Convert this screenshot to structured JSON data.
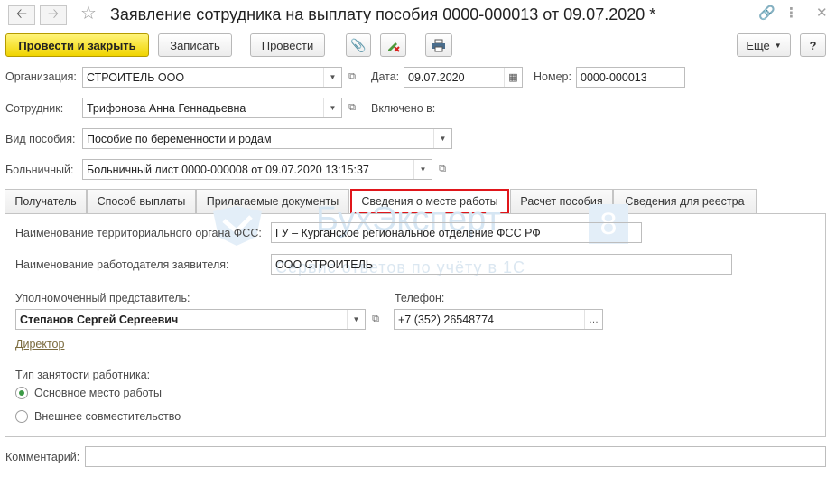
{
  "window": {
    "title": "Заявление сотрудника на выплату пособия 0000-000013 от 09.07.2020 *",
    "back_icon": "arrow-left-icon",
    "forward_icon": "arrow-right-icon",
    "favorite_icon": "star-icon",
    "link_icon": "link-icon",
    "more_icon": "vertical-dots-icon",
    "maximize_icon": "maximize-icon",
    "close_icon": "close-icon"
  },
  "toolbar": {
    "post_close": "Провести и закрыть",
    "save": "Записать",
    "post": "Провести",
    "more": "Еще",
    "help": "?",
    "attach_icon": "paperclip-icon",
    "clear_icon": "pencil-cross-icon",
    "print_icon": "printer-icon"
  },
  "header": {
    "org_label": "Организация:",
    "org_value": "СТРОИТЕЛЬ ООО",
    "date_label": "Дата:",
    "date_value": "09.07.2020",
    "number_label": "Номер:",
    "number_value": "0000-000013",
    "employee_label": "Сотрудник:",
    "employee_value": "Трифонова Анна Геннадьевна",
    "included_label": "Включено в:",
    "benefit_label": "Вид пособия:",
    "benefit_value": "Пособие по беременности и родам",
    "sick_label": "Больничный:",
    "sick_value": "Больничный лист 0000-000008 от 09.07.2020 13:15:37"
  },
  "tabs": [
    {
      "label": "Получатель"
    },
    {
      "label": "Способ выплаты"
    },
    {
      "label": "Прилагаемые документы"
    },
    {
      "label": "Сведения о месте работы"
    },
    {
      "label": "Расчет пособия"
    },
    {
      "label": "Сведения для реестра"
    }
  ],
  "work": {
    "fss_label": "Наименование территориального органа ФСС:",
    "fss_value": "ГУ – Курганское региональное отделение ФСС РФ",
    "employer_label": "Наименование работодателя заявителя:",
    "employer_value": "ООО СТРОИТЕЛЬ",
    "rep_label": "Уполномоченный представитель:",
    "rep_value": "Степанов Сергей Сергеевич",
    "phone_label": "Телефон:",
    "phone_value": "+7 (352) 26548774",
    "position_link": "Директор",
    "employment_label": "Тип занятости работника:",
    "employment_options": [
      "Основное место работы",
      "Внешнее совместительство"
    ],
    "employment_selected": 0
  },
  "comment_label": "Комментарий:",
  "comment_value": "",
  "watermark": {
    "brand": "БухЭксперт",
    "digit": "8",
    "slogan": "Сервис ответов по учёту в 1С"
  },
  "colors": {
    "primary_button": "#f0d400",
    "active_tab_outline": "#e0161b",
    "link": "#7a6a3c",
    "radio_on": "#3c9a46"
  }
}
